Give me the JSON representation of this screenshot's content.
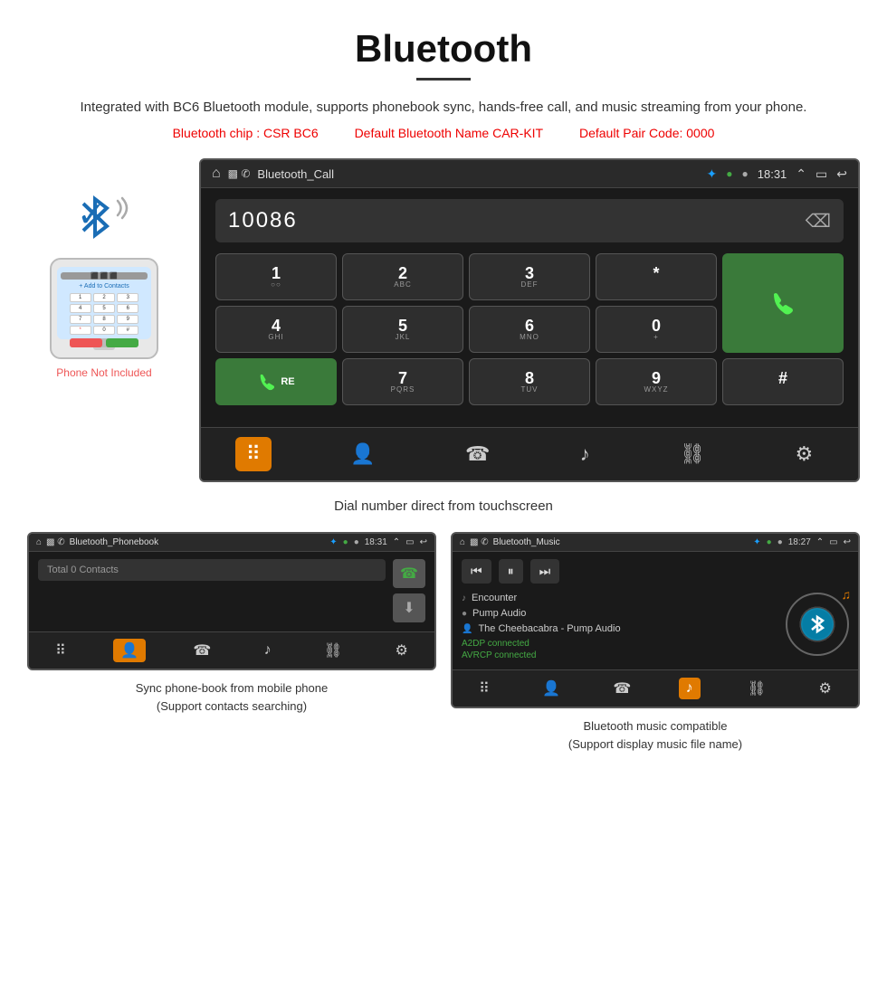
{
  "page": {
    "title": "Bluetooth",
    "description": "Integrated with BC6 Bluetooth module, supports phonebook sync, hands-free call, and music streaming from your phone.",
    "spec_chip": "Bluetooth chip : CSR BC6",
    "spec_name": "Default Bluetooth Name CAR-KIT",
    "spec_code": "Default Pair Code: 0000"
  },
  "main_screen": {
    "header_title": "Bluetooth_Call",
    "time": "18:31",
    "dialer_number": "10086",
    "keys": [
      {
        "main": "1",
        "sub": "○○"
      },
      {
        "main": "2",
        "sub": "ABC"
      },
      {
        "main": "3",
        "sub": "DEF"
      },
      {
        "main": "*",
        "sub": ""
      },
      {
        "main": "☎",
        "sub": ""
      },
      {
        "main": "4",
        "sub": "GHI"
      },
      {
        "main": "5",
        "sub": "JKL"
      },
      {
        "main": "6",
        "sub": "MNO"
      },
      {
        "main": "0",
        "sub": "+"
      },
      {
        "main": "RE☎",
        "sub": ""
      },
      {
        "main": "7",
        "sub": "PQRS"
      },
      {
        "main": "8",
        "sub": "TUV"
      },
      {
        "main": "9",
        "sub": "WXYZ"
      },
      {
        "main": "#",
        "sub": ""
      }
    ],
    "bottom_icons": [
      "⋮⋮⋮",
      "👤",
      "☎",
      "♪",
      "🔗",
      "⚙"
    ]
  },
  "phone": {
    "not_included": "Phone Not Included"
  },
  "main_caption": "Dial number direct from touchscreen",
  "phonebook_screen": {
    "header_title": "Bluetooth_Phonebook",
    "time": "18:31",
    "search_placeholder": "Total 0 Contacts",
    "bottom_icons": [
      "⋮⋮⋮",
      "👤",
      "☎",
      "♪",
      "🔗",
      "⚙"
    ]
  },
  "music_screen": {
    "header_title": "Bluetooth_Music",
    "time": "18:27",
    "tracks": [
      {
        "icon": "♪",
        "name": "Encounter"
      },
      {
        "icon": "●",
        "name": "Pump Audio"
      },
      {
        "icon": "👤",
        "name": "The Cheebacabra - Pump Audio"
      }
    ],
    "status": [
      "A2DP connected",
      "AVRCP connected"
    ],
    "bottom_icons": [
      "⋮⋮⋮",
      "👤",
      "☎",
      "♪",
      "🔗",
      "⚙"
    ]
  },
  "phonebook_caption": {
    "line1": "Sync phone-book from mobile phone",
    "line2": "(Support contacts searching)"
  },
  "music_caption": {
    "line1": "Bluetooth music compatible",
    "line2": "(Support display music file name)"
  }
}
